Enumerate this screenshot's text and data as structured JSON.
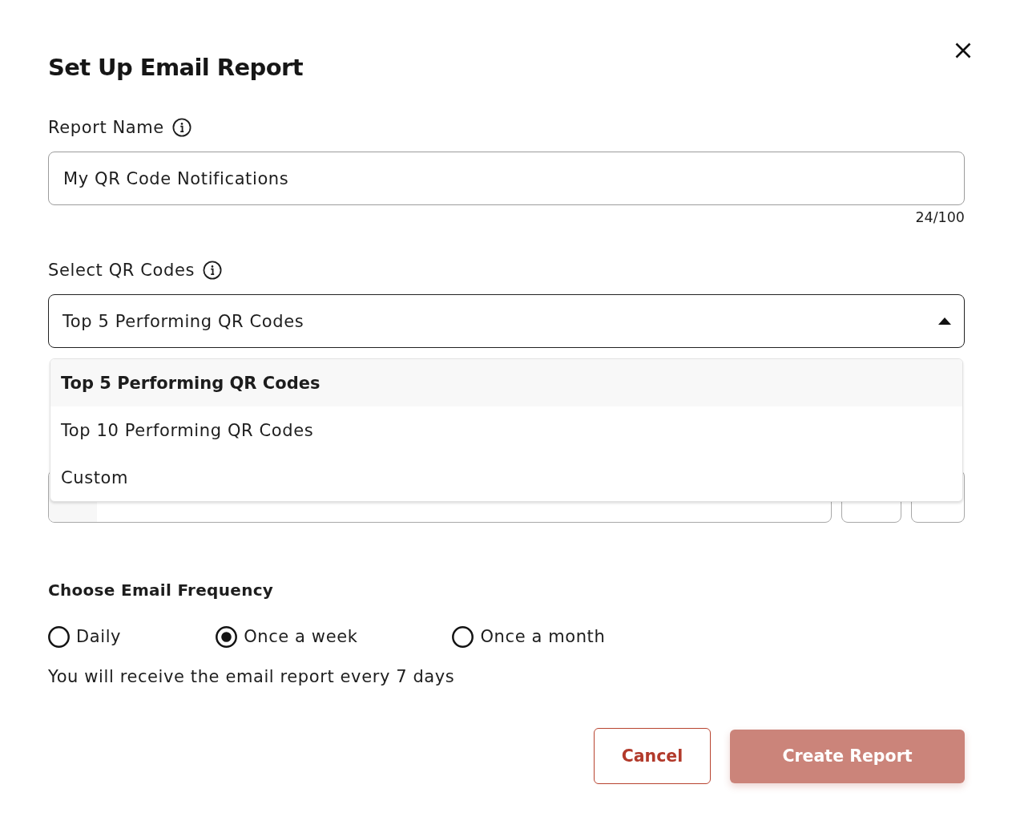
{
  "dialog": {
    "title": "Set Up Email Report"
  },
  "report_name": {
    "label": "Report Name",
    "value": "My QR Code Notifications",
    "counter": "24/100"
  },
  "select_qr_codes": {
    "label": "Select QR Codes",
    "value": "Top 5 Performing QR Codes",
    "expanded": true,
    "options": [
      {
        "label": "Top 5 Performing QR Codes",
        "selected": true
      },
      {
        "label": "Top 10 Performing QR Codes",
        "selected": false
      },
      {
        "label": "Custom",
        "selected": false
      }
    ]
  },
  "frequency": {
    "heading": "Choose Email Frequency",
    "options": [
      {
        "label": "Daily",
        "selected": false
      },
      {
        "label": "Once a week",
        "selected": true
      },
      {
        "label": "Once a month",
        "selected": false
      }
    ],
    "note": "You will receive the email report every 7 days"
  },
  "buttons": [
    {
      "label": "Cancel",
      "kind": "secondary",
      "disabled": false
    },
    {
      "label": "Create Report",
      "kind": "primary",
      "disabled": true
    }
  ]
}
